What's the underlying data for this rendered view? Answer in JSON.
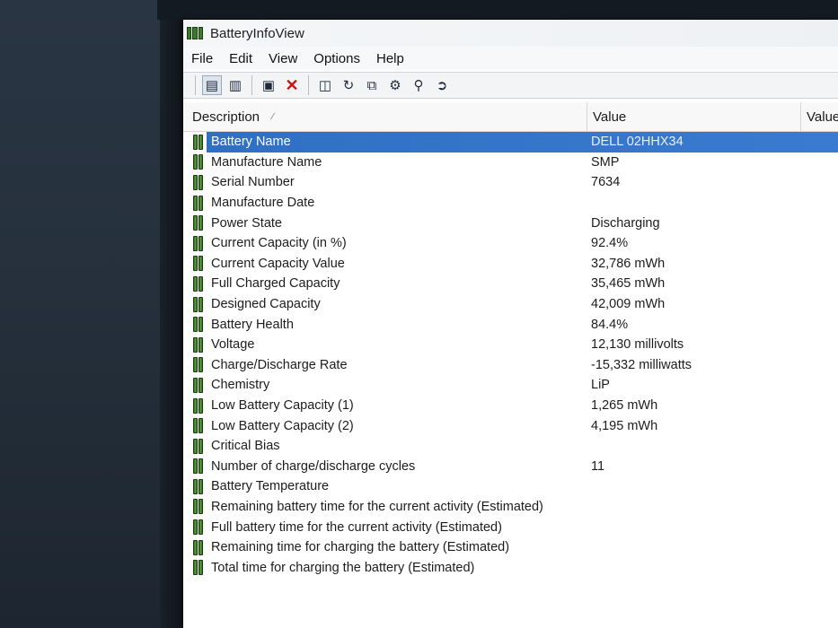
{
  "window": {
    "title": "BatteryInfoView"
  },
  "menu": [
    "File",
    "Edit",
    "View",
    "Options",
    "Help"
  ],
  "toolbar": [
    {
      "icon": "html-report-icon"
    },
    {
      "icon": "text-report-icon"
    },
    {
      "icon": "properties-icon"
    },
    {
      "icon": "delete-icon"
    },
    {
      "icon": "save-icon"
    },
    {
      "icon": "refresh-icon"
    },
    {
      "icon": "copy-icon"
    },
    {
      "icon": "options-icon"
    },
    {
      "icon": "find-icon"
    },
    {
      "icon": "exit-icon"
    }
  ],
  "columns": {
    "description": "Description",
    "value": "Value",
    "value2": "Value"
  },
  "rows": [
    {
      "description": "Battery Name",
      "value": "DELL 02HHX34",
      "selected": true
    },
    {
      "description": "Manufacture Name",
      "value": "SMP"
    },
    {
      "description": "Serial Number",
      "value": "7634"
    },
    {
      "description": "Manufacture Date",
      "value": ""
    },
    {
      "description": "Power State",
      "value": "Discharging"
    },
    {
      "description": "Current Capacity (in %)",
      "value": "92.4%"
    },
    {
      "description": "Current Capacity Value",
      "value": "32,786 mWh"
    },
    {
      "description": "Full Charged Capacity",
      "value": "35,465 mWh"
    },
    {
      "description": "Designed Capacity",
      "value": "42,009 mWh"
    },
    {
      "description": "Battery Health",
      "value": "84.4%"
    },
    {
      "description": "Voltage",
      "value": "12,130 millivolts"
    },
    {
      "description": "Charge/Discharge Rate",
      "value": "-15,332 milliwatts"
    },
    {
      "description": "Chemistry",
      "value": "LiP"
    },
    {
      "description": "Low Battery Capacity (1)",
      "value": "1,265 mWh"
    },
    {
      "description": "Low Battery Capacity (2)",
      "value": "4,195 mWh"
    },
    {
      "description": "Critical Bias",
      "value": ""
    },
    {
      "description": "Number of charge/discharge cycles",
      "value": "11"
    },
    {
      "description": "Battery Temperature",
      "value": ""
    },
    {
      "description": "Remaining battery time for the current activity (Estimated)",
      "value": ""
    },
    {
      "description": "Full battery time for the current activity (Estimated)",
      "value": ""
    },
    {
      "description": "Remaining time for charging the battery (Estimated)",
      "value": ""
    },
    {
      "description": "Total  time for charging the battery (Estimated)",
      "value": ""
    }
  ],
  "colors": {
    "selection": "#2f6fc4",
    "battery_icon": "#3a7a2a"
  }
}
